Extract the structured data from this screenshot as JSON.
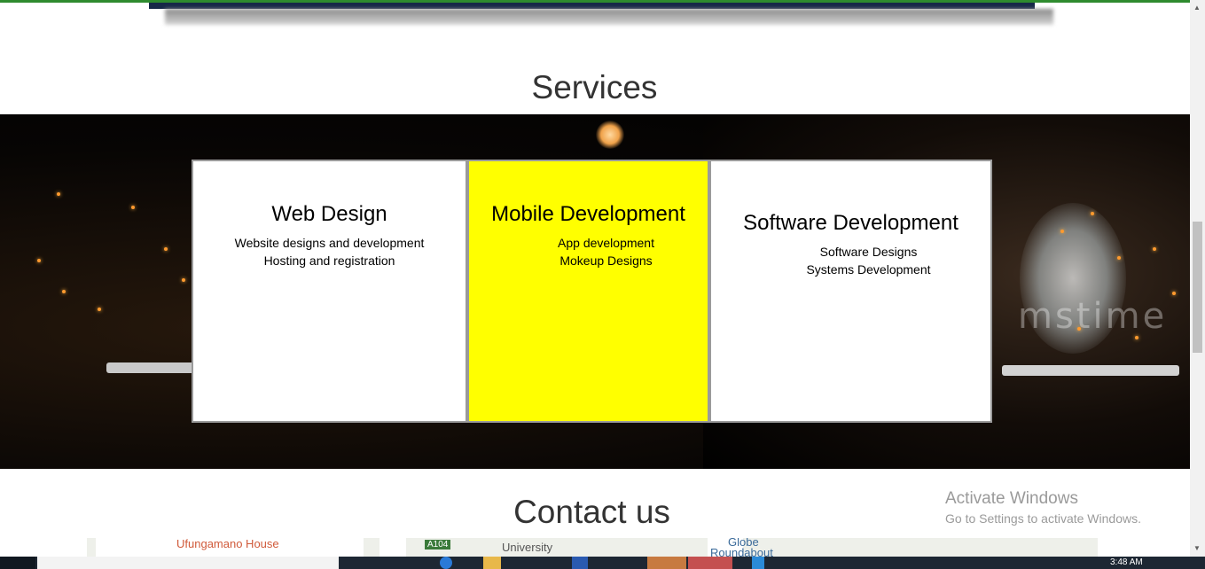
{
  "services": {
    "title": "Services",
    "cards": [
      {
        "title": "Web Design",
        "lines": [
          "Website designs and development",
          "Hosting and registration"
        ],
        "background": "#ffffff"
      },
      {
        "title": "Mobile Development",
        "lines": [
          "App development",
          "Mokeup Designs"
        ],
        "background": "#ffff00"
      },
      {
        "title": "Software Development",
        "lines": [
          "Software Designs",
          "Systems Development"
        ],
        "background": "#ffffff"
      }
    ]
  },
  "contact": {
    "title": "Contact us"
  },
  "map": {
    "labels": [
      "Ufungamano House",
      "A104",
      "University",
      "Globe",
      "Roundabout"
    ]
  },
  "watermark": "mstime",
  "activation": {
    "line1": "Activate Windows",
    "line2": "Go to Settings to activate Windows."
  },
  "taskbar": {
    "time": "3:48 AM"
  },
  "colors": {
    "accent_top": "#2e8b2e",
    "hero_bar": "#172848",
    "highlight": "#ffff00"
  }
}
